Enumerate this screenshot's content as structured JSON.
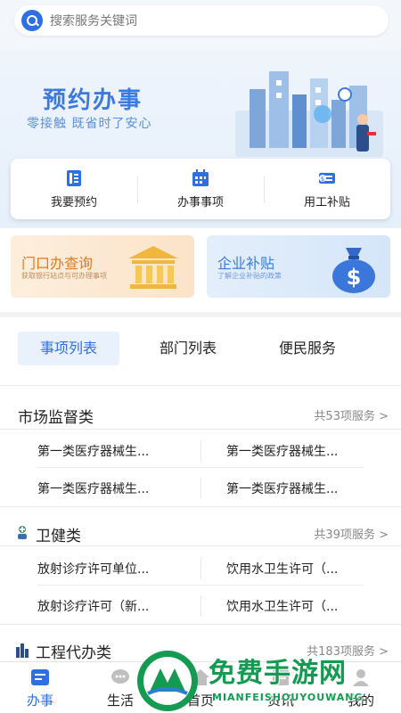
{
  "search": {
    "placeholder": "搜索服务关键词"
  },
  "banner": {
    "title": "预约办事",
    "subtitle": "零接触  既省时了安心"
  },
  "quick_actions": [
    {
      "label": "我要预约",
      "icon": "phone-booking-icon"
    },
    {
      "label": "办事事项",
      "icon": "calendar-icon"
    },
    {
      "label": "用工补贴",
      "icon": "money-icon"
    }
  ],
  "promos": {
    "left": {
      "title": "门口办查询",
      "subtitle": "获取银行站点与可办理事项",
      "icon": "bank-icon"
    },
    "right": {
      "title": "企业补贴",
      "subtitle": "了解企业补贴的政策",
      "icon": "money-bag-icon"
    }
  },
  "tabs": [
    {
      "label": "事项列表",
      "active": true
    },
    {
      "label": "部门列表",
      "active": false
    },
    {
      "label": "便民服务",
      "active": false
    }
  ],
  "sections": [
    {
      "title": "市场监督类",
      "count": "共53项服务 >",
      "items": [
        "第一类医疗器械生...",
        "第一类医疗器械生...",
        "第一类医疗器械生...",
        "第一类医疗器械生..."
      ]
    },
    {
      "title": "卫健类",
      "count": "共39项服务 >",
      "icon": "health-icon",
      "items": [
        "放射诊疗许可单位...",
        "饮用水卫生许可（...",
        "放射诊疗许可（新...",
        "饮用水卫生许可（..."
      ]
    },
    {
      "title": "工程代办类",
      "count": "共183项服务 >",
      "icon": "building-icon"
    }
  ],
  "bottom_nav": [
    {
      "label": "办事",
      "icon": "service-icon",
      "active": true
    },
    {
      "label": "生活",
      "icon": "chat-icon",
      "active": false
    },
    {
      "label": "首页",
      "icon": "home-icon",
      "active": false
    },
    {
      "label": "资讯",
      "icon": "news-icon",
      "active": false
    },
    {
      "label": "我的",
      "icon": "user-icon",
      "active": false
    }
  ],
  "watermark": {
    "text": "免费手游网",
    "url": "MIANFEISHOUYOUWANG"
  },
  "colors": {
    "accent": "#2f6fe4",
    "orange": "#e07a1f",
    "watermark": "#159a52"
  }
}
